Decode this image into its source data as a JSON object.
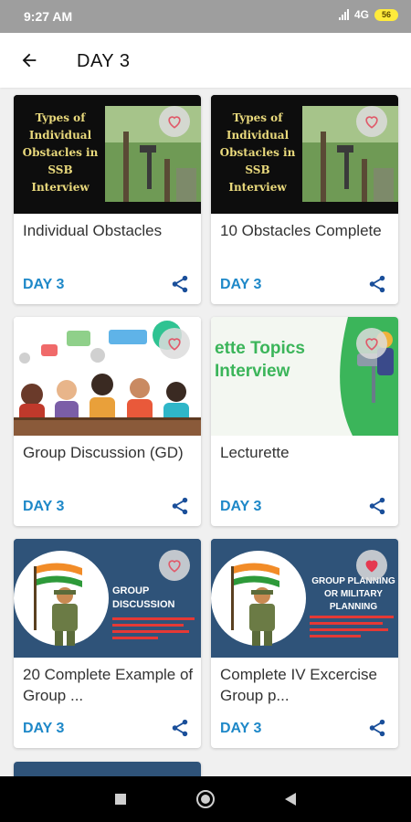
{
  "status_bar": {
    "time": "9:27 AM",
    "network": "4G",
    "battery": "56"
  },
  "header": {
    "title": "DAY 3"
  },
  "cards": [
    {
      "title": "Individual Obstacles",
      "day": "DAY 3",
      "thumb_text": "Types of Individual Obstacles in SSB Interview"
    },
    {
      "title": "10 Obstacles Complete",
      "day": "DAY 3",
      "thumb_text": "Types of Individual Obstacles in SSB Interview"
    },
    {
      "title": "Group Discussion (GD)",
      "day": "DAY 3"
    },
    {
      "title": "Lecturette",
      "day": "DAY 3",
      "thumb_text": "ette Topics Interview"
    },
    {
      "title": "20 Complete Example of Group ...",
      "day": "DAY 3",
      "thumb_text": "GROUP DISCUSSION"
    },
    {
      "title": "Complete IV Excercise Group p...",
      "day": "DAY 3",
      "thumb_text": "GROUP PLANNING OR MILITARY PLANNING"
    }
  ],
  "icons": {
    "back": "arrow-left-icon",
    "favorite": "heart-icon",
    "share": "share-icon"
  },
  "colors": {
    "accent": "#1e88c8",
    "favorite_active": "#e53950",
    "favorite_inactive": "#e05a6a",
    "thumb_dark": "#0d0d0d",
    "thumb_navy": "#2f5379",
    "lecturette_green": "#3bb55a"
  }
}
